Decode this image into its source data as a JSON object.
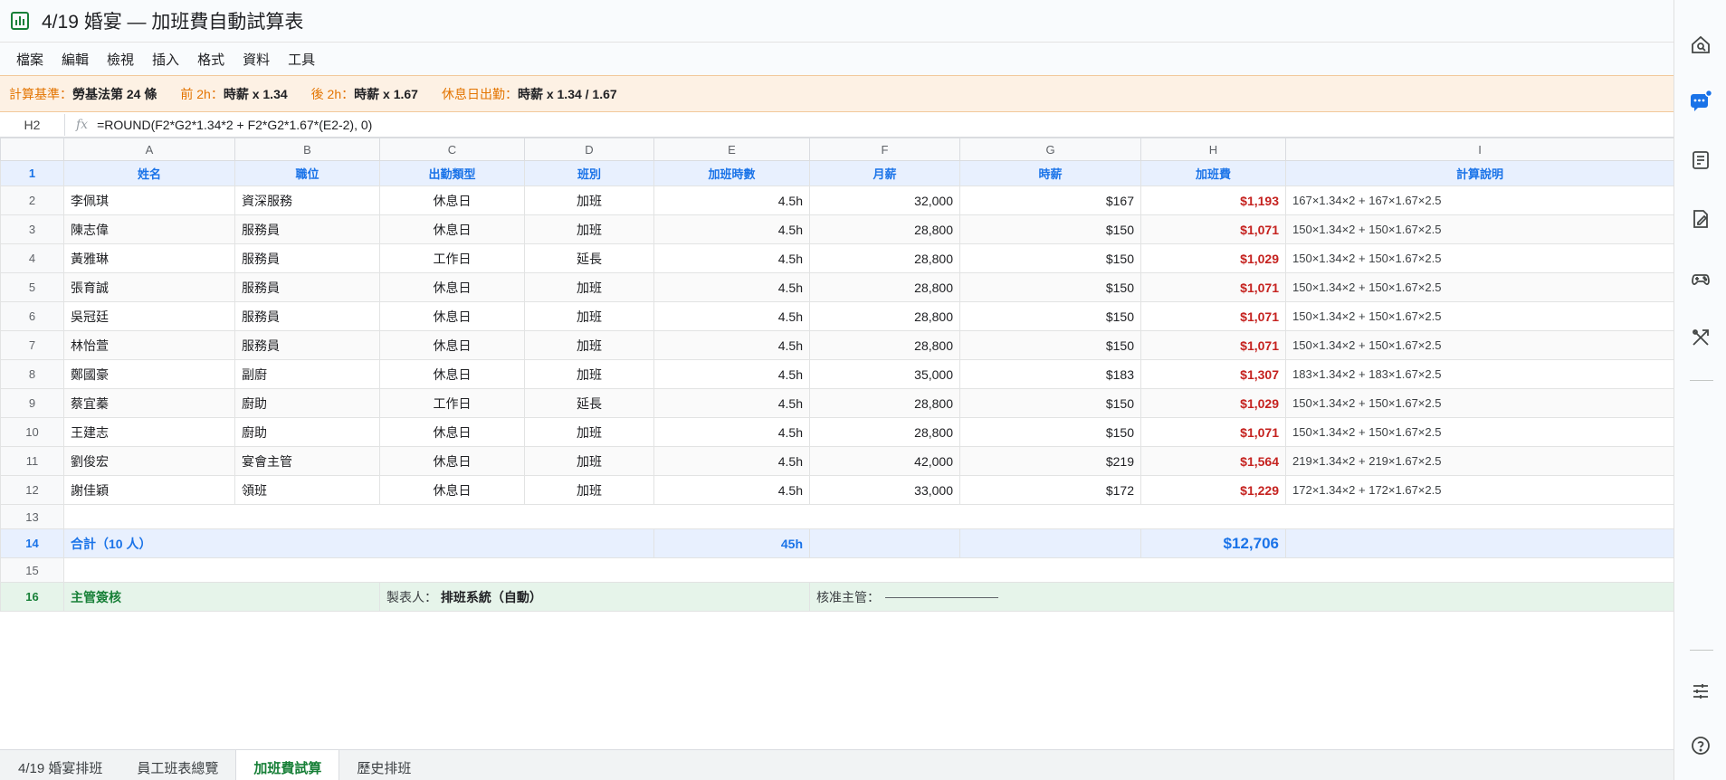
{
  "title": "4/19 婚宴 — 加班費自動試算表",
  "menu": [
    "檔案",
    "編輯",
    "檢視",
    "插入",
    "格式",
    "資料",
    "工具"
  ],
  "banner": [
    {
      "k": "計算基準：",
      "v": "勞基法第 24 條"
    },
    {
      "k": "前 2h：",
      "v": "時薪 x 1.34"
    },
    {
      "k": "後 2h：",
      "v": "時薪 x 1.67"
    },
    {
      "k": "休息日出勤：",
      "v": "時薪 x 1.34 / 1.67"
    }
  ],
  "cell_ref": "H2",
  "fx": "fx",
  "formula": "=ROUND(F2*G2*1.34*2 + F2*G2*1.67*(E2-2), 0)",
  "col_letters": [
    "A",
    "B",
    "C",
    "D",
    "E",
    "F",
    "G",
    "H",
    "I"
  ],
  "headers": [
    "姓名",
    "職位",
    "出勤類型",
    "班別",
    "加班時數",
    "月薪",
    "時薪",
    "加班費",
    "計算說明"
  ],
  "rows": [
    {
      "n": "2",
      "name": "李佩琪",
      "role": "資深服務",
      "type": "休息日",
      "shift": "加班",
      "hours": "4.5h",
      "salary": "32,000",
      "wage": "$167",
      "fee": "$1,193",
      "note": "167×1.34×2 + 167×1.67×2.5"
    },
    {
      "n": "3",
      "name": "陳志偉",
      "role": "服務員",
      "type": "休息日",
      "shift": "加班",
      "hours": "4.5h",
      "salary": "28,800",
      "wage": "$150",
      "fee": "$1,071",
      "note": "150×1.34×2 + 150×1.67×2.5"
    },
    {
      "n": "4",
      "name": "黃雅琳",
      "role": "服務員",
      "type": "工作日",
      "shift": "延長",
      "hours": "4.5h",
      "salary": "28,800",
      "wage": "$150",
      "fee": "$1,029",
      "note": "150×1.34×2 + 150×1.67×2.5"
    },
    {
      "n": "5",
      "name": "張育誠",
      "role": "服務員",
      "type": "休息日",
      "shift": "加班",
      "hours": "4.5h",
      "salary": "28,800",
      "wage": "$150",
      "fee": "$1,071",
      "note": "150×1.34×2 + 150×1.67×2.5"
    },
    {
      "n": "6",
      "name": "吳冠廷",
      "role": "服務員",
      "type": "休息日",
      "shift": "加班",
      "hours": "4.5h",
      "salary": "28,800",
      "wage": "$150",
      "fee": "$1,071",
      "note": "150×1.34×2 + 150×1.67×2.5"
    },
    {
      "n": "7",
      "name": "林怡萱",
      "role": "服務員",
      "type": "休息日",
      "shift": "加班",
      "hours": "4.5h",
      "salary": "28,800",
      "wage": "$150",
      "fee": "$1,071",
      "note": "150×1.34×2 + 150×1.67×2.5"
    },
    {
      "n": "8",
      "name": "鄭國豪",
      "role": "副廚",
      "type": "休息日",
      "shift": "加班",
      "hours": "4.5h",
      "salary": "35,000",
      "wage": "$183",
      "fee": "$1,307",
      "note": "183×1.34×2 + 183×1.67×2.5"
    },
    {
      "n": "9",
      "name": "蔡宜蓁",
      "role": "廚助",
      "type": "工作日",
      "shift": "延長",
      "hours": "4.5h",
      "salary": "28,800",
      "wage": "$150",
      "fee": "$1,029",
      "note": "150×1.34×2 + 150×1.67×2.5"
    },
    {
      "n": "10",
      "name": "王建志",
      "role": "廚助",
      "type": "休息日",
      "shift": "加班",
      "hours": "4.5h",
      "salary": "28,800",
      "wage": "$150",
      "fee": "$1,071",
      "note": "150×1.34×2 + 150×1.67×2.5"
    },
    {
      "n": "11",
      "name": "劉俊宏",
      "role": "宴會主管",
      "type": "休息日",
      "shift": "加班",
      "hours": "4.5h",
      "salary": "42,000",
      "wage": "$219",
      "fee": "$1,564",
      "note": "219×1.34×2 + 219×1.67×2.5"
    },
    {
      "n": "12",
      "name": "謝佳穎",
      "role": "領班",
      "type": "休息日",
      "shift": "加班",
      "hours": "4.5h",
      "salary": "33,000",
      "wage": "$172",
      "fee": "$1,229",
      "note": "172×1.34×2 + 172×1.67×2.5"
    }
  ],
  "row13": "13",
  "total": {
    "n": "14",
    "label": "合計（10 人）",
    "hours": "45h",
    "fee": "$12,706"
  },
  "row15": "15",
  "sign": {
    "n": "16",
    "label": "主管簽核",
    "maker_k": "製表人：",
    "maker_v": "排班系統（自動）",
    "approver": "核准主管："
  },
  "tabs": [
    "4/19 婚宴排班",
    "員工班表總覽",
    "加班費試算",
    "歷史排班"
  ],
  "active_tab": 2,
  "colors": {
    "accent_blue": "#1a73e8",
    "fee_red": "#c5221f",
    "sheets_green": "#188038",
    "banner_orange": "#e37400"
  },
  "sidebar_icons": [
    "search-history-icon",
    "chat-notify-icon",
    "notes-icon",
    "edit-task-icon",
    "gamepad-icon",
    "tools-icon",
    "sliders-icon",
    "help-icon"
  ]
}
